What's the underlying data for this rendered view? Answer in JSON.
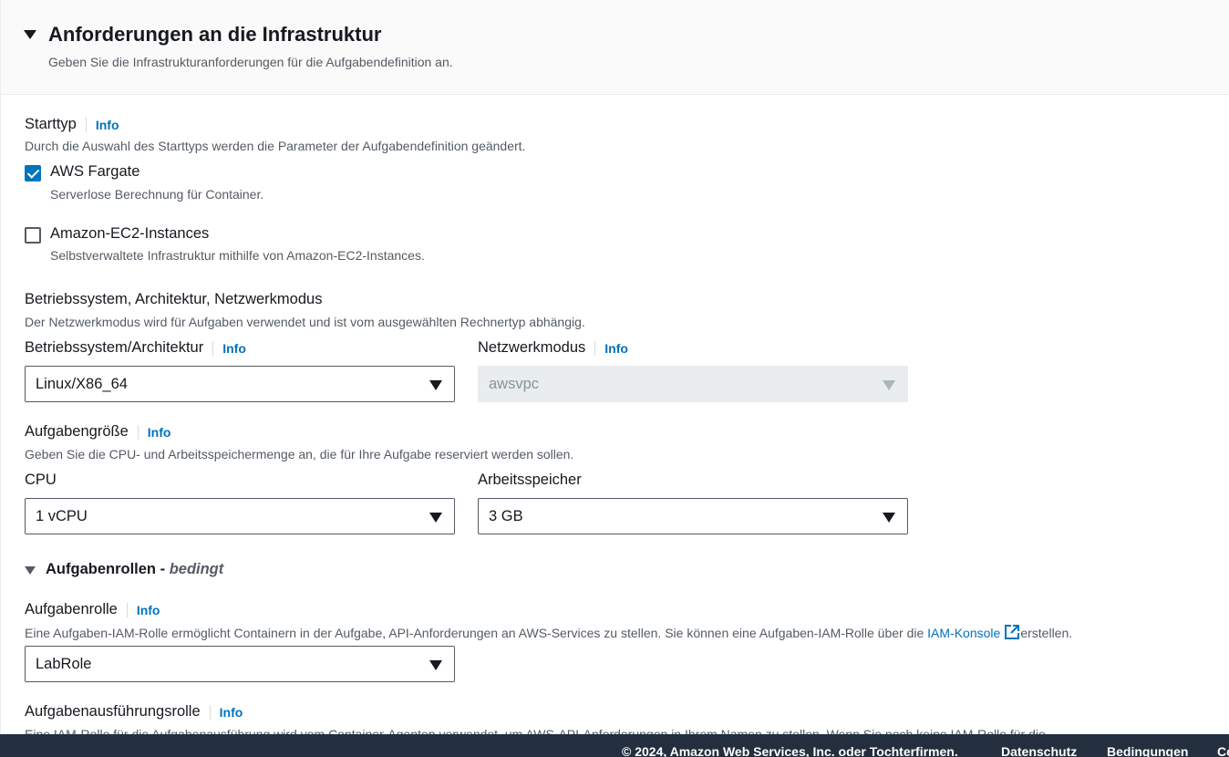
{
  "header": {
    "title": "Anforderungen an die Infrastruktur",
    "description": "Geben Sie die Infrastrukturanforderungen für die Aufgabendefinition an."
  },
  "launch_type": {
    "label": "Starttyp",
    "info": "Info",
    "description": "Durch die Auswahl des Starttyps werden die Parameter der Aufgabendefinition geändert.",
    "options": [
      {
        "label": "AWS Fargate",
        "description": "Serverlose Berechnung für Container.",
        "checked": true
      },
      {
        "label": "Amazon-EC2-Instances",
        "description": "Selbstverwaltete Infrastruktur mithilfe von Amazon-EC2-Instances.",
        "checked": false
      }
    ]
  },
  "os_arch_network": {
    "label": "Betriebssystem, Architektur, Netzwerkmodus",
    "description": "Der Netzwerkmodus wird für Aufgaben verwendet und ist vom ausgewählten Rechnertyp abhängig.",
    "os_arch": {
      "label": "Betriebssystem/Architektur",
      "info": "Info",
      "value": "Linux/X86_64"
    },
    "network_mode": {
      "label": "Netzwerkmodus",
      "info": "Info",
      "value": "awsvpc"
    }
  },
  "task_size": {
    "label": "Aufgabengröße",
    "info": "Info",
    "description": "Geben Sie die CPU- und Arbeitsspeichermenge an, die für Ihre Aufgabe reserviert werden sollen.",
    "cpu": {
      "label": "CPU",
      "value": "1 vCPU"
    },
    "memory": {
      "label": "Arbeitsspeicher",
      "value": "3 GB"
    }
  },
  "task_roles": {
    "section_title": "Aufgabenrollen -",
    "section_title_suffix": "bedingt",
    "task_role": {
      "label": "Aufgabenrolle",
      "info": "Info",
      "description_pre": "Eine Aufgaben-IAM-Rolle ermöglicht Containern in der Aufgabe, API-Anforderungen an AWS-Services zu stellen. Sie können eine Aufgaben-IAM-Rolle über die",
      "link": "IAM-Konsole",
      "description_post": "erstellen.",
      "value": "LabRole"
    },
    "execution_role": {
      "label": "Aufgabenausführungsrolle",
      "info": "Info",
      "description": "Eine IAM-Rolle für die Aufgabenausführung wird vom Container-Agenten verwendet, um AWS-API-Anforderungen in Ihrem Namen zu stellen. Wenn Sie noch keine IAM-Rolle für die"
    }
  },
  "footer": {
    "copyright": "© 2024, Amazon Web Services, Inc. oder Tochterfirmen.",
    "privacy": "Datenschutz",
    "terms": "Bedingungen",
    "cookies": "Co"
  },
  "colors": {
    "link": "#0073bb",
    "checkbox_checked": "#0073bb",
    "footer_bg": "#232f3e",
    "header_bg": "#fafafa"
  }
}
